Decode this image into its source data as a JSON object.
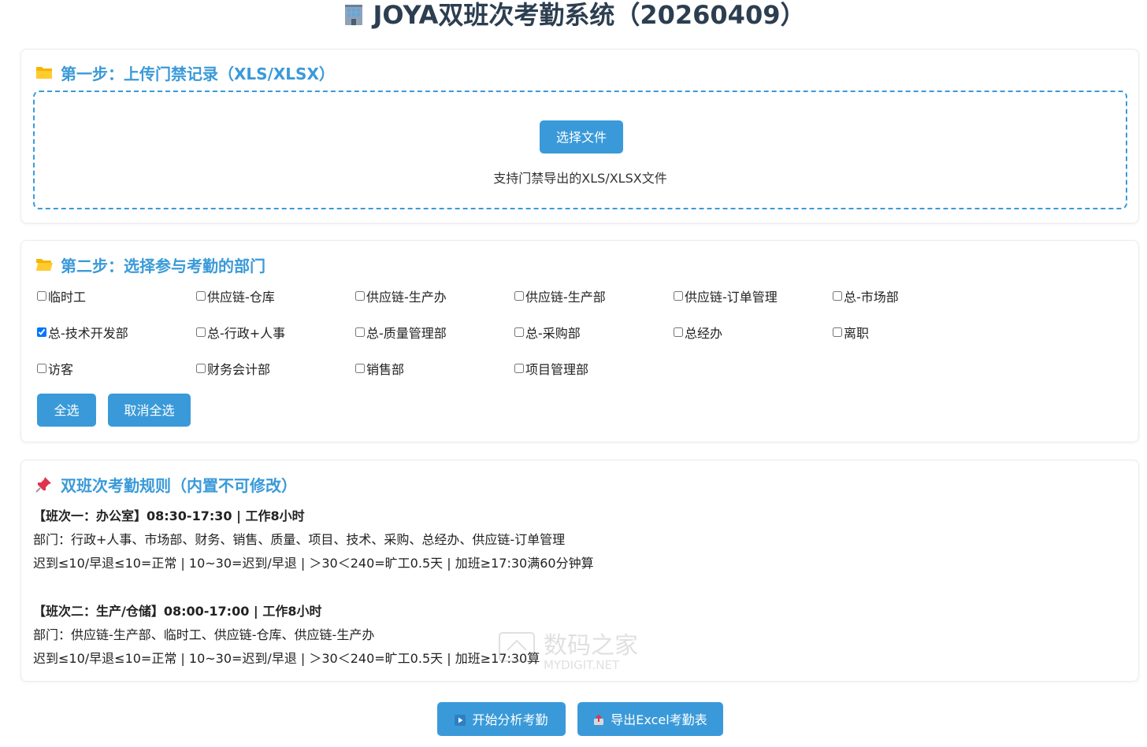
{
  "page": {
    "title": "JOYA双班次考勤系统（20260409）",
    "title_icon": "office-building-icon"
  },
  "upload": {
    "heading": "第一步：上传门禁记录（XLS/XLSX）",
    "heading_icon": "folder-icon",
    "choose_button": "选择文件",
    "hint": "支持门禁导出的XLS/XLSX文件"
  },
  "departments": {
    "heading": "第二步：选择参与考勤的部门",
    "heading_icon": "open-folder-icon",
    "items": [
      {
        "label": "临时工",
        "checked": false
      },
      {
        "label": "供应链-仓库",
        "checked": false
      },
      {
        "label": "供应链-生产办",
        "checked": false
      },
      {
        "label": "供应链-生产部",
        "checked": false
      },
      {
        "label": "供应链-订单管理",
        "checked": false
      },
      {
        "label": "总-市场部",
        "checked": false
      },
      {
        "label": "总-技术开发部",
        "checked": true
      },
      {
        "label": "总-行政+人事",
        "checked": false
      },
      {
        "label": "总-质量管理部",
        "checked": false
      },
      {
        "label": "总-采购部",
        "checked": false
      },
      {
        "label": "总经办",
        "checked": false
      },
      {
        "label": "离职",
        "checked": false
      },
      {
        "label": "访客",
        "checked": false
      },
      {
        "label": "财务会计部",
        "checked": false
      },
      {
        "label": "销售部",
        "checked": false
      },
      {
        "label": "项目管理部",
        "checked": false
      }
    ],
    "select_all": "全选",
    "deselect_all": "取消全选"
  },
  "rules": {
    "heading": "双班次考勤规则（内置不可修改）",
    "heading_icon": "pushpin-icon",
    "shift1": {
      "title": "【班次一：办公室】08:30-17:30 | 工作8小时",
      "departments": "部门：行政+人事、市场部、财务、销售、质量、项目、技术、采购、总经办、供应链-订单管理",
      "policy": "迟到≤10/早退≤10=正常 | 10~30=迟到/早退 | ＞30＜240=旷工0.5天 | 加班≥17:30满60分钟算"
    },
    "shift2": {
      "title": "【班次二：生产/仓储】08:00-17:00 | 工作8小时",
      "departments": "部门：供应链-生产部、临时工、供应链-仓库、供应链-生产办",
      "policy": "迟到≤10/早退≤10=正常 | 10~30=迟到/早退 | ＞30＜240=旷工0.5天 | 加班≥17:30算"
    }
  },
  "actions": {
    "start_label": "开始分析考勤",
    "start_icon": "play-icon",
    "export_label": "导出Excel考勤表",
    "export_icon": "export-icon"
  },
  "watermark": {
    "text": "数码之家",
    "subtext": "MYDIGIT.NET"
  },
  "colors": {
    "accent": "#3a9ad9",
    "title": "#2c3e50",
    "pushpin": "#e0334f",
    "folder": "#f5b400"
  }
}
